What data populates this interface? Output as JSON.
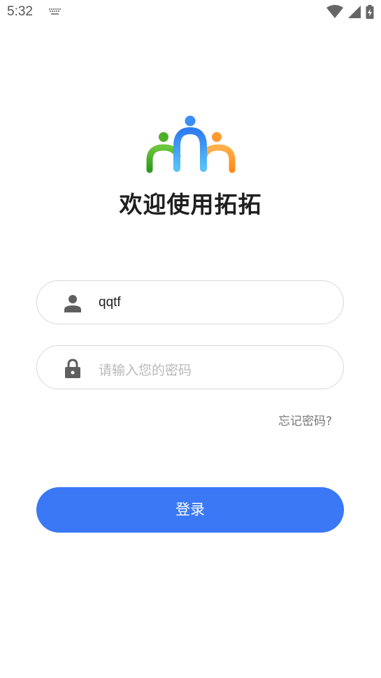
{
  "status_bar": {
    "time": "5:32",
    "icons": [
      "keyboard-icon",
      "wifi-icon",
      "cellular-icon",
      "battery-charging-icon"
    ]
  },
  "app": {
    "logo": "people-logo-icon",
    "title": "欢迎使用拓拓",
    "brand_colors": {
      "green": "#4caf2a",
      "blue": "#3a8ef6",
      "orange": "#ff9a2e",
      "primary_button": "#3a78f5"
    }
  },
  "form": {
    "username": {
      "icon": "person-icon",
      "value": "qqtf"
    },
    "password": {
      "icon": "lock-icon",
      "value": "",
      "placeholder": "请输入您的密码"
    },
    "forgot_password": "忘记密码?",
    "login_button": "登录"
  }
}
